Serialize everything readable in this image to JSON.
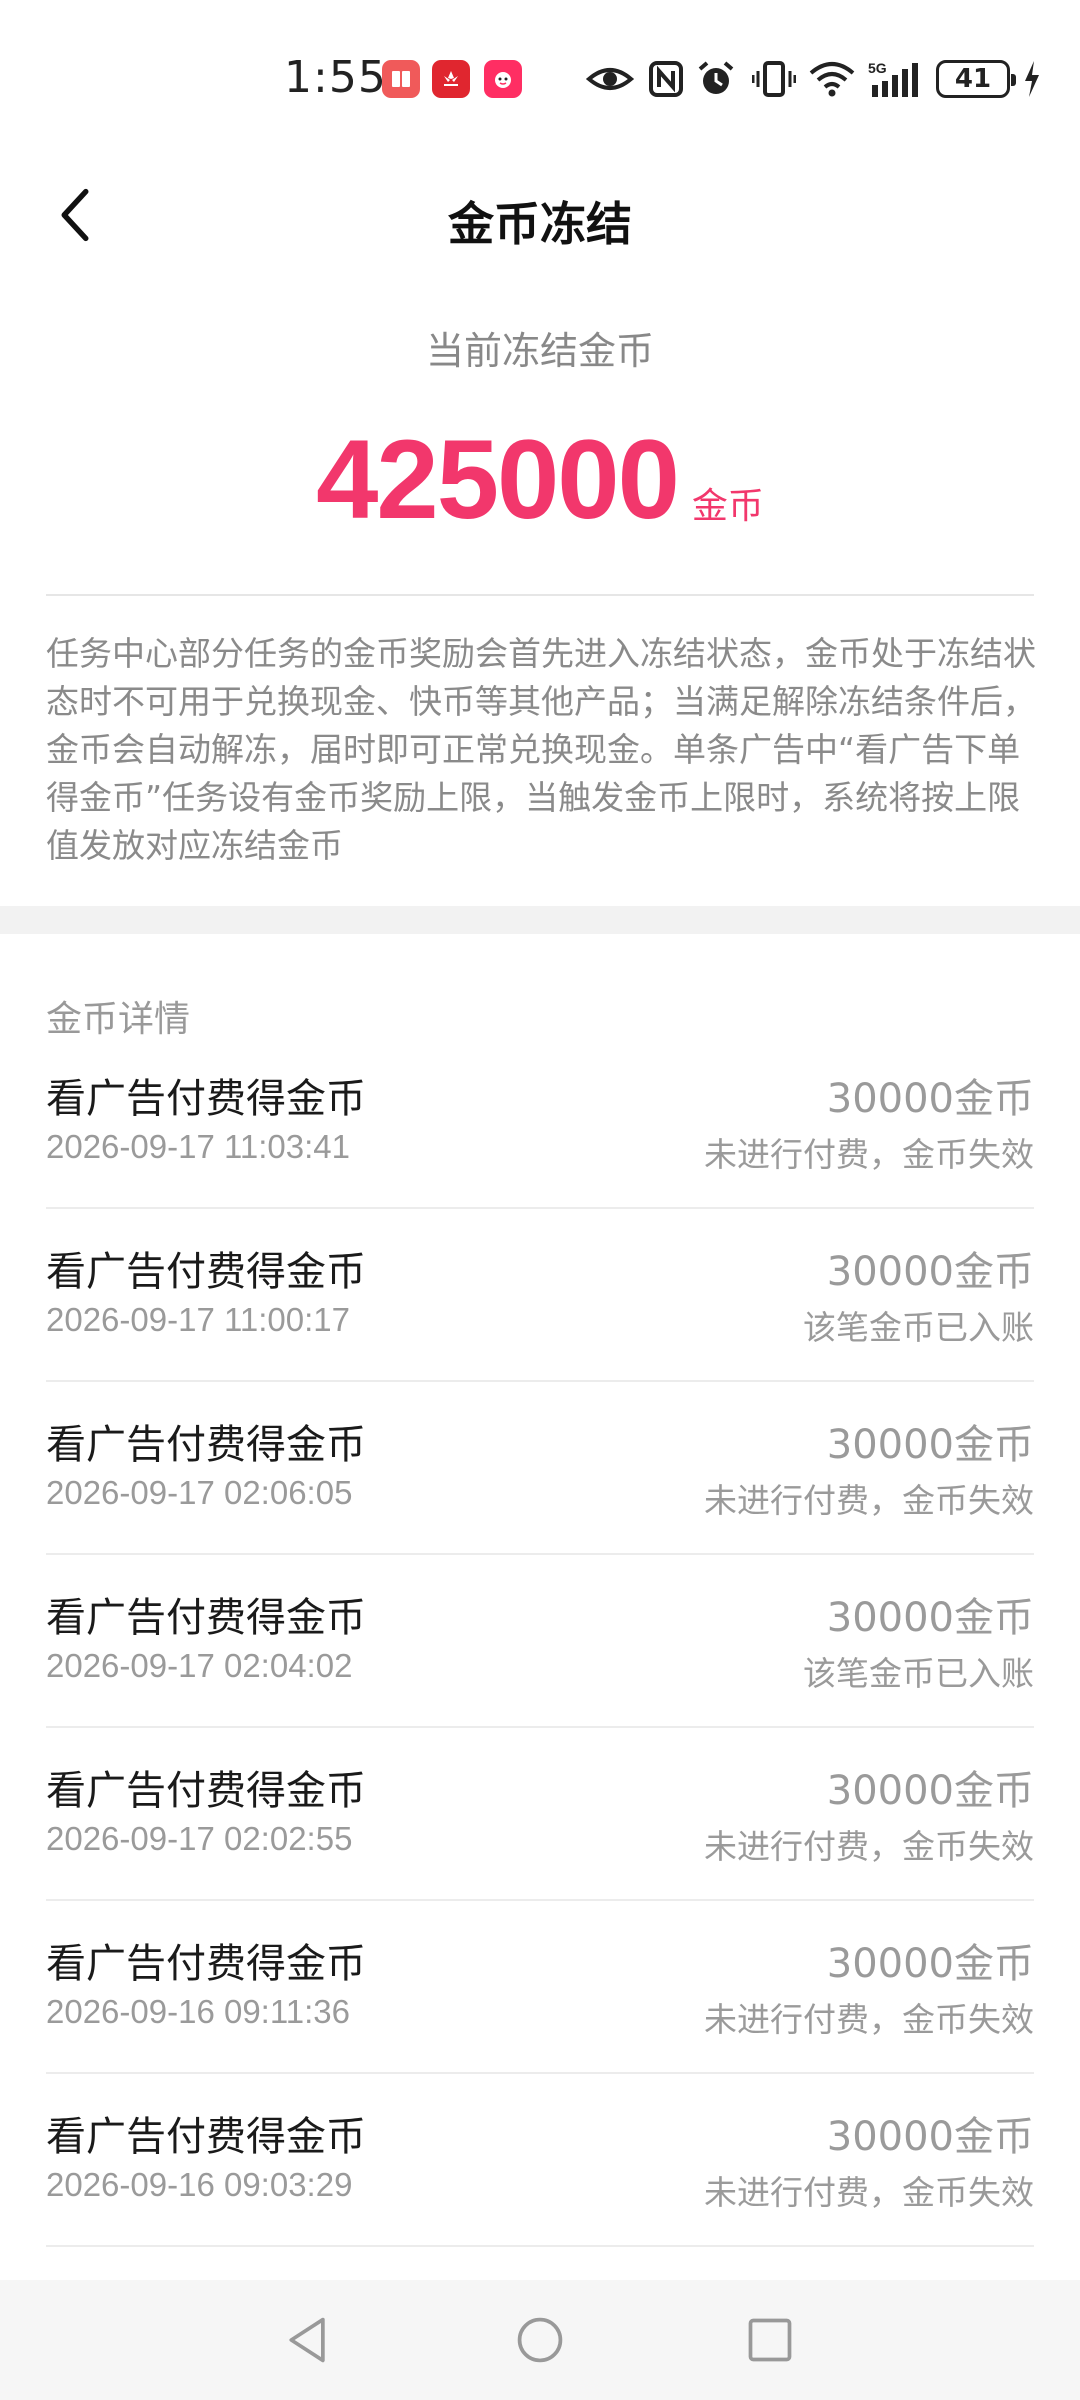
{
  "status_bar": {
    "time": "1:55",
    "network": "5G",
    "battery": "41",
    "icons": [
      "book-app-icon",
      "huawei-app-icon",
      "mascot-app-icon",
      "eye-icon",
      "nfc-icon",
      "alarm-icon",
      "vibrate-icon",
      "wifi-icon",
      "signal-icon",
      "charging-icon"
    ]
  },
  "header": {
    "title": "金币冻结",
    "back_icon": "chevron-left-icon"
  },
  "summary": {
    "label": "当前冻结金币",
    "amount": "425000",
    "unit": "金币",
    "accent_color": "#f2376c"
  },
  "description": "任务中心部分任务的金币奖励会首先进入冻结状态，金币处于冻结状态时不可用于兑换现金、快币等其他产品；当满足解除冻结条件后，金币会自动解冻，届时即可正常兑换现金。单条广告中“看广告下单得金币”任务设有金币奖励上限，当触发金币上限时，系统将按上限值发放对应冻结金币",
  "details": {
    "section_title": "金币详情",
    "items": [
      {
        "title": "看广告付费得金币",
        "time": "2026-09-17 11:03:41",
        "amount": "30000金币",
        "status": "未进行付费，金币失效"
      },
      {
        "title": "看广告付费得金币",
        "time": "2026-09-17 11:00:17",
        "amount": "30000金币",
        "status": "该笔金币已入账"
      },
      {
        "title": "看广告付费得金币",
        "time": "2026-09-17 02:06:05",
        "amount": "30000金币",
        "status": "未进行付费，金币失效"
      },
      {
        "title": "看广告付费得金币",
        "time": "2026-09-17 02:04:02",
        "amount": "30000金币",
        "status": "该笔金币已入账"
      },
      {
        "title": "看广告付费得金币",
        "time": "2026-09-17 02:02:55",
        "amount": "30000金币",
        "status": "未进行付费，金币失效"
      },
      {
        "title": "看广告付费得金币",
        "time": "2026-09-16 09:11:36",
        "amount": "30000金币",
        "status": "未进行付费，金币失效"
      },
      {
        "title": "看广告付费得金币",
        "time": "2026-09-16 09:03:29",
        "amount": "30000金币",
        "status": "未进行付费，金币失效"
      }
    ]
  },
  "system_nav": [
    "back-triangle-icon",
    "home-circle-icon",
    "recents-square-icon"
  ]
}
